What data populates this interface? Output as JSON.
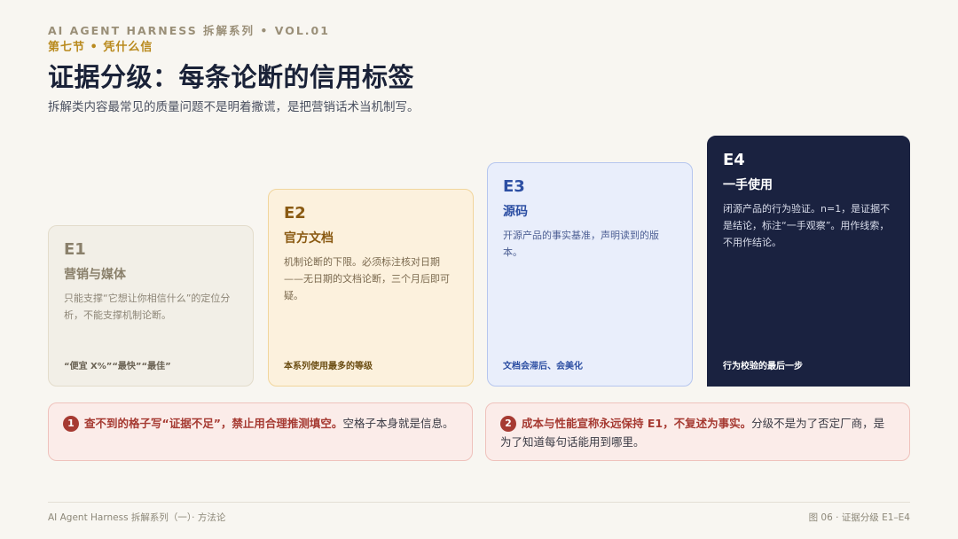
{
  "header": {
    "kicker": "AI AGENT HARNESS 拆解系列 • VOL.01",
    "section": "第七节 • 凭什么信",
    "title": "证据分级：每条论断的信用标签",
    "subtitle": "拆解类内容最常见的质量问题不是明着撒谎，是把营销话术当机制写。"
  },
  "levels": [
    {
      "level": "E1",
      "name": "营销与媒体",
      "desc": "只能支撑“它想让你相信什么”的定位分析，不能支撑机制论断。",
      "foot": "“便宜 X%”“最快”“最佳”",
      "color": "#f2efe7"
    },
    {
      "level": "E2",
      "name": "官方文档",
      "desc": "机制论断的下限。必须标注核对日期——无日期的文档论断，三个月后即可疑。",
      "foot": "本系列使用最多的等级",
      "color": "#fcf1dd"
    },
    {
      "level": "E3",
      "name": "源码",
      "desc": "开源产品的事实基准，声明读到的版本。",
      "foot": "文档会滞后、会美化",
      "color": "#e9eefb"
    },
    {
      "level": "E4",
      "name": "一手使用",
      "desc": "闭源产品的行为验证。n=1，是证据不是结论，标注“一手观察”。用作线索，不用作结论。",
      "foot": "行为校验的最后一步",
      "color": "#1a2240"
    }
  ],
  "notes": [
    {
      "num": "1",
      "strong": "查不到的格子写“证据不足”，禁止用合理推测填空。",
      "rest": "空格子本身就是信息。"
    },
    {
      "num": "2",
      "strong": "成本与性能宣称永远保持 E1，不复述为事实。",
      "rest": "分级不是为了否定厂商，是为了知道每句话能用到哪里。"
    }
  ],
  "footer": {
    "left": "AI Agent Harness 拆解系列（一）· 方法论",
    "right": "图 06 · 证据分级 E1–E4"
  }
}
